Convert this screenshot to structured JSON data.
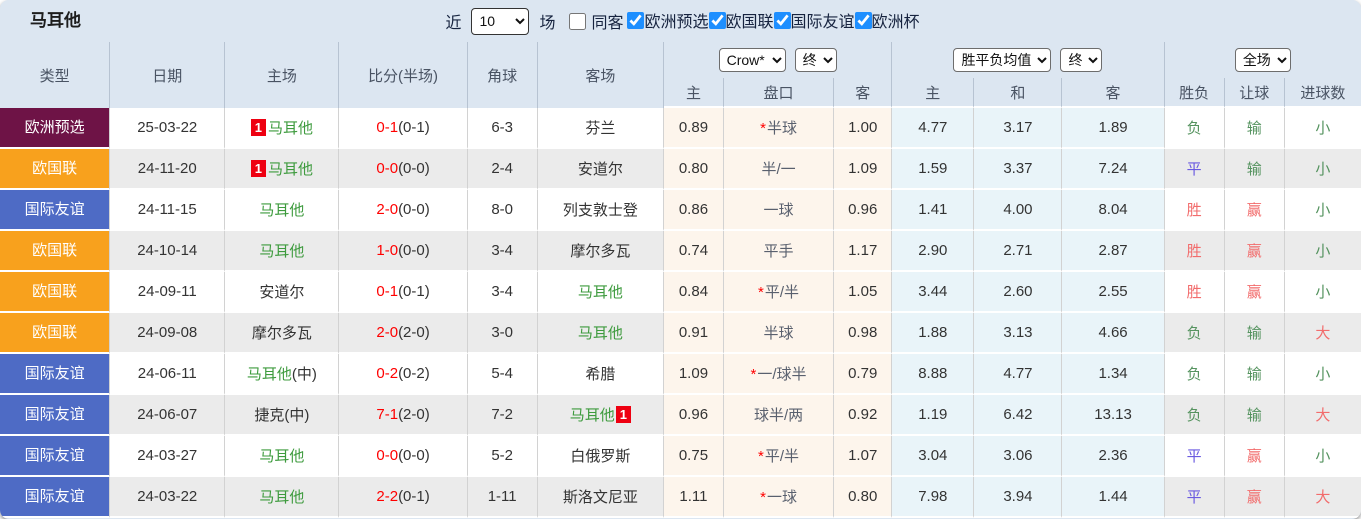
{
  "title": "马耳他",
  "topbar": {
    "near_label": "近",
    "near_value": "10",
    "games_label": "场",
    "same_away_label": "同客",
    "same_away_checked": false,
    "competitions": [
      {
        "label": "欧洲预选",
        "checked": true
      },
      {
        "label": "欧国联",
        "checked": true
      },
      {
        "label": "国际友谊",
        "checked": true
      },
      {
        "label": "欧洲杯",
        "checked": true
      }
    ]
  },
  "table": {
    "main_headers": [
      "类型",
      "日期",
      "主场",
      "比分(半场)",
      "角球",
      "客场"
    ],
    "groups": [
      {
        "selects": [
          "Crow*",
          "终"
        ],
        "subcols": [
          "主",
          "盘口",
          "客"
        ]
      },
      {
        "selects": [
          "胜平负均值",
          "终"
        ],
        "subcols": [
          "主",
          "和",
          "客"
        ]
      },
      {
        "selects": [
          "全场"
        ],
        "subcols": [
          "胜负",
          "让球",
          "进球数"
        ]
      }
    ],
    "rows": [
      {
        "type": "欧洲预选",
        "type_color": "#6e1346",
        "date": "25-03-22",
        "home": {
          "badge": "1",
          "name": "马耳他",
          "malta": true,
          "suffix": ""
        },
        "score": {
          "full": "0-1",
          "half": "(0-1)"
        },
        "corner": "6-3",
        "away": {
          "badge": "",
          "name": "芬兰",
          "malta": false,
          "suffix": ""
        },
        "asian": {
          "home": "0.89",
          "star": true,
          "handicap": "半球",
          "away": "1.00"
        },
        "euro": {
          "home": "4.77",
          "draw": "3.17",
          "away": "1.89"
        },
        "results": [
          {
            "text": "负",
            "tone": "green"
          },
          {
            "text": "输",
            "tone": "green"
          },
          {
            "text": "小",
            "tone": "green"
          }
        ]
      },
      {
        "type": "欧国联",
        "type_color": "#f8a11d",
        "date": "24-11-20",
        "home": {
          "badge": "1",
          "name": "马耳他",
          "malta": true,
          "suffix": ""
        },
        "score": {
          "full": "0-0",
          "half": "(0-0)"
        },
        "corner": "2-4",
        "away": {
          "badge": "",
          "name": "安道尔",
          "malta": false,
          "suffix": ""
        },
        "asian": {
          "home": "0.80",
          "star": false,
          "handicap": "半/一",
          "away": "1.09"
        },
        "euro": {
          "home": "1.59",
          "draw": "3.37",
          "away": "7.24"
        },
        "results": [
          {
            "text": "平",
            "tone": "blue"
          },
          {
            "text": "输",
            "tone": "green"
          },
          {
            "text": "小",
            "tone": "green"
          }
        ]
      },
      {
        "type": "国际友谊",
        "type_color": "#4e6bc5",
        "date": "24-11-15",
        "home": {
          "badge": "",
          "name": "马耳他",
          "malta": true,
          "suffix": ""
        },
        "score": {
          "full": "2-0",
          "half": "(0-0)"
        },
        "corner": "8-0",
        "away": {
          "badge": "",
          "name": "列支敦士登",
          "malta": false,
          "suffix": ""
        },
        "asian": {
          "home": "0.86",
          "star": false,
          "handicap": "一球",
          "away": "0.96"
        },
        "euro": {
          "home": "1.41",
          "draw": "4.00",
          "away": "8.04"
        },
        "results": [
          {
            "text": "胜",
            "tone": "red"
          },
          {
            "text": "赢",
            "tone": "red"
          },
          {
            "text": "小",
            "tone": "green"
          }
        ]
      },
      {
        "type": "欧国联",
        "type_color": "#f8a11d",
        "date": "24-10-14",
        "home": {
          "badge": "",
          "name": "马耳他",
          "malta": true,
          "suffix": ""
        },
        "score": {
          "full": "1-0",
          "half": "(0-0)"
        },
        "corner": "3-4",
        "away": {
          "badge": "",
          "name": "摩尔多瓦",
          "malta": false,
          "suffix": ""
        },
        "asian": {
          "home": "0.74",
          "star": false,
          "handicap": "平手",
          "away": "1.17"
        },
        "euro": {
          "home": "2.90",
          "draw": "2.71",
          "away": "2.87"
        },
        "results": [
          {
            "text": "胜",
            "tone": "red"
          },
          {
            "text": "赢",
            "tone": "red"
          },
          {
            "text": "小",
            "tone": "green"
          }
        ]
      },
      {
        "type": "欧国联",
        "type_color": "#f8a11d",
        "date": "24-09-11",
        "home": {
          "badge": "",
          "name": "安道尔",
          "malta": false,
          "suffix": ""
        },
        "score": {
          "full": "0-1",
          "half": "(0-1)"
        },
        "corner": "3-4",
        "away": {
          "badge": "",
          "name": "马耳他",
          "malta": true,
          "suffix": ""
        },
        "asian": {
          "home": "0.84",
          "star": true,
          "handicap": "平/半",
          "away": "1.05"
        },
        "euro": {
          "home": "3.44",
          "draw": "2.60",
          "away": "2.55"
        },
        "results": [
          {
            "text": "胜",
            "tone": "red"
          },
          {
            "text": "赢",
            "tone": "red"
          },
          {
            "text": "小",
            "tone": "green"
          }
        ]
      },
      {
        "type": "欧国联",
        "type_color": "#f8a11d",
        "date": "24-09-08",
        "home": {
          "badge": "",
          "name": "摩尔多瓦",
          "malta": false,
          "suffix": ""
        },
        "score": {
          "full": "2-0",
          "half": "(2-0)"
        },
        "corner": "3-0",
        "away": {
          "badge": "",
          "name": "马耳他",
          "malta": true,
          "suffix": ""
        },
        "asian": {
          "home": "0.91",
          "star": false,
          "handicap": "半球",
          "away": "0.98"
        },
        "euro": {
          "home": "1.88",
          "draw": "3.13",
          "away": "4.66"
        },
        "results": [
          {
            "text": "负",
            "tone": "green"
          },
          {
            "text": "输",
            "tone": "green"
          },
          {
            "text": "大",
            "tone": "red"
          }
        ]
      },
      {
        "type": "国际友谊",
        "type_color": "#4e6bc5",
        "date": "24-06-11",
        "home": {
          "badge": "",
          "name": "马耳他",
          "malta": true,
          "suffix": "(中)"
        },
        "score": {
          "full": "0-2",
          "half": "(0-2)"
        },
        "corner": "5-4",
        "away": {
          "badge": "",
          "name": "希腊",
          "malta": false,
          "suffix": ""
        },
        "asian": {
          "home": "1.09",
          "star": true,
          "handicap": "一/球半",
          "away": "0.79"
        },
        "euro": {
          "home": "8.88",
          "draw": "4.77",
          "away": "1.34"
        },
        "results": [
          {
            "text": "负",
            "tone": "green"
          },
          {
            "text": "输",
            "tone": "green"
          },
          {
            "text": "小",
            "tone": "green"
          }
        ]
      },
      {
        "type": "国际友谊",
        "type_color": "#4e6bc5",
        "date": "24-06-07",
        "home": {
          "badge": "",
          "name": "捷克",
          "malta": false,
          "suffix": "(中)"
        },
        "score": {
          "full": "7-1",
          "half": "(2-0)"
        },
        "corner": "7-2",
        "away": {
          "badge": "1",
          "name": "马耳他",
          "malta": true,
          "suffix": ""
        },
        "asian": {
          "home": "0.96",
          "star": false,
          "handicap": "球半/两",
          "away": "0.92"
        },
        "euro": {
          "home": "1.19",
          "draw": "6.42",
          "away": "13.13"
        },
        "results": [
          {
            "text": "负",
            "tone": "green"
          },
          {
            "text": "输",
            "tone": "green"
          },
          {
            "text": "大",
            "tone": "red"
          }
        ]
      },
      {
        "type": "国际友谊",
        "type_color": "#4e6bc5",
        "date": "24-03-27",
        "home": {
          "badge": "",
          "name": "马耳他",
          "malta": true,
          "suffix": ""
        },
        "score": {
          "full": "0-0",
          "half": "(0-0)"
        },
        "corner": "5-2",
        "away": {
          "badge": "",
          "name": "白俄罗斯",
          "malta": false,
          "suffix": ""
        },
        "asian": {
          "home": "0.75",
          "star": true,
          "handicap": "平/半",
          "away": "1.07"
        },
        "euro": {
          "home": "3.04",
          "draw": "3.06",
          "away": "2.36"
        },
        "results": [
          {
            "text": "平",
            "tone": "blue"
          },
          {
            "text": "赢",
            "tone": "red"
          },
          {
            "text": "小",
            "tone": "green"
          }
        ]
      },
      {
        "type": "国际友谊",
        "type_color": "#4e6bc5",
        "date": "24-03-22",
        "home": {
          "badge": "",
          "name": "马耳他",
          "malta": true,
          "suffix": ""
        },
        "score": {
          "full": "2-2",
          "half": "(0-1)"
        },
        "corner": "1-11",
        "away": {
          "badge": "",
          "name": "斯洛文尼亚",
          "malta": false,
          "suffix": ""
        },
        "asian": {
          "home": "1.11",
          "star": true,
          "handicap": "一球",
          "away": "0.80"
        },
        "euro": {
          "home": "7.98",
          "draw": "3.94",
          "away": "1.44"
        },
        "results": [
          {
            "text": "平",
            "tone": "blue"
          },
          {
            "text": "赢",
            "tone": "red"
          },
          {
            "text": "大",
            "tone": "red"
          }
        ]
      }
    ]
  },
  "colors": {
    "panel_bg": "#dce6f1",
    "type_euro_qualifier": "#6e1346",
    "type_nations_league": "#f8a11d",
    "type_friendly": "#4e6bc5",
    "team_green": "#3e9b3e",
    "score_red": "#ff0000",
    "result_red": "#f26c6c",
    "result_green": "#55935f",
    "result_blue": "#6a5ae0",
    "asian_col_bg": "#fdf5ec",
    "euro_col_bg": "#e9f4f9",
    "stripe_bg": "#ebebeb",
    "badge_red": "#ee0011"
  }
}
